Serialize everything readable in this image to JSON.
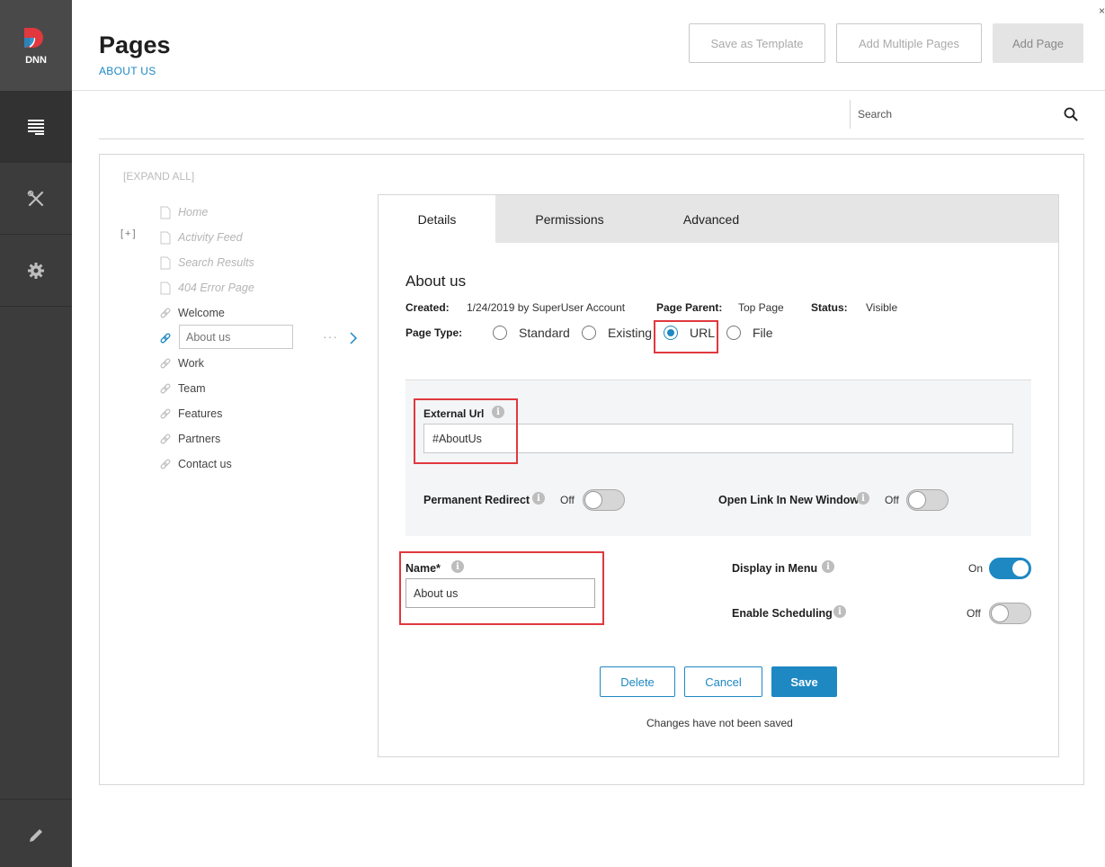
{
  "sidebar": {
    "logo_text": "DNN",
    "items": [
      {
        "name": "pages",
        "icon": "pages-list-icon"
      },
      {
        "name": "tools",
        "icon": "tools-icon"
      },
      {
        "name": "settings",
        "icon": "gear-icon"
      },
      {
        "name": "edit",
        "icon": "pencil-icon"
      }
    ]
  },
  "header": {
    "title": "Pages",
    "breadcrumb": "ABOUT US",
    "buttons": {
      "save_template": "Save as Template",
      "add_multiple": "Add Multiple Pages",
      "add_page": "Add Page"
    },
    "close": "×"
  },
  "search": {
    "placeholder": "Search"
  },
  "tree": {
    "expand_all": "[EXPAND ALL]",
    "expand_toggle": "[+]",
    "items": [
      {
        "label": "Home",
        "state": "disabled"
      },
      {
        "label": "Activity Feed",
        "state": "disabled"
      },
      {
        "label": "Search Results",
        "state": "disabled"
      },
      {
        "label": "404 Error Page",
        "state": "disabled"
      },
      {
        "label": "Welcome",
        "state": "normal"
      },
      {
        "label": "About us",
        "state": "editing"
      },
      {
        "label": "Work",
        "state": "normal"
      },
      {
        "label": "Team",
        "state": "normal"
      },
      {
        "label": "Features",
        "state": "normal"
      },
      {
        "label": "Partners",
        "state": "normal"
      },
      {
        "label": "Contact us",
        "state": "normal"
      }
    ],
    "dots": "···"
  },
  "tabs": {
    "details": "Details",
    "permissions": "Permissions",
    "advanced": "Advanced"
  },
  "details": {
    "heading": "About us",
    "created_label": "Created:",
    "created_value": "1/24/2019 by SuperUser Account",
    "parent_label": "Page Parent:",
    "parent_value": "Top Page",
    "status_label": "Status:",
    "status_value": "Visible",
    "page_type_label": "Page Type:",
    "page_types": {
      "standard": "Standard",
      "existing": "Existing",
      "url": "URL",
      "file": "File"
    },
    "selected_page_type": "URL"
  },
  "url_section": {
    "external_url_label": "External Url",
    "external_url_value": "#AboutUs",
    "permanent_redirect_label": "Permanent Redirect",
    "permanent_redirect_state": "Off",
    "open_new_window_label": "Open Link In New Window",
    "open_new_window_state": "Off"
  },
  "fields": {
    "name_label": "Name*",
    "name_value": "About us",
    "display_menu_label": "Display in Menu",
    "display_menu_state": "On",
    "scheduling_label": "Enable Scheduling",
    "scheduling_state": "Off"
  },
  "actions": {
    "delete": "Delete",
    "cancel": "Cancel",
    "save": "Save",
    "unsaved": "Changes have not been saved"
  },
  "colors": {
    "accent": "#1e88c3",
    "highlight": "#e0383e",
    "sidebar": "#3d3c3c"
  }
}
